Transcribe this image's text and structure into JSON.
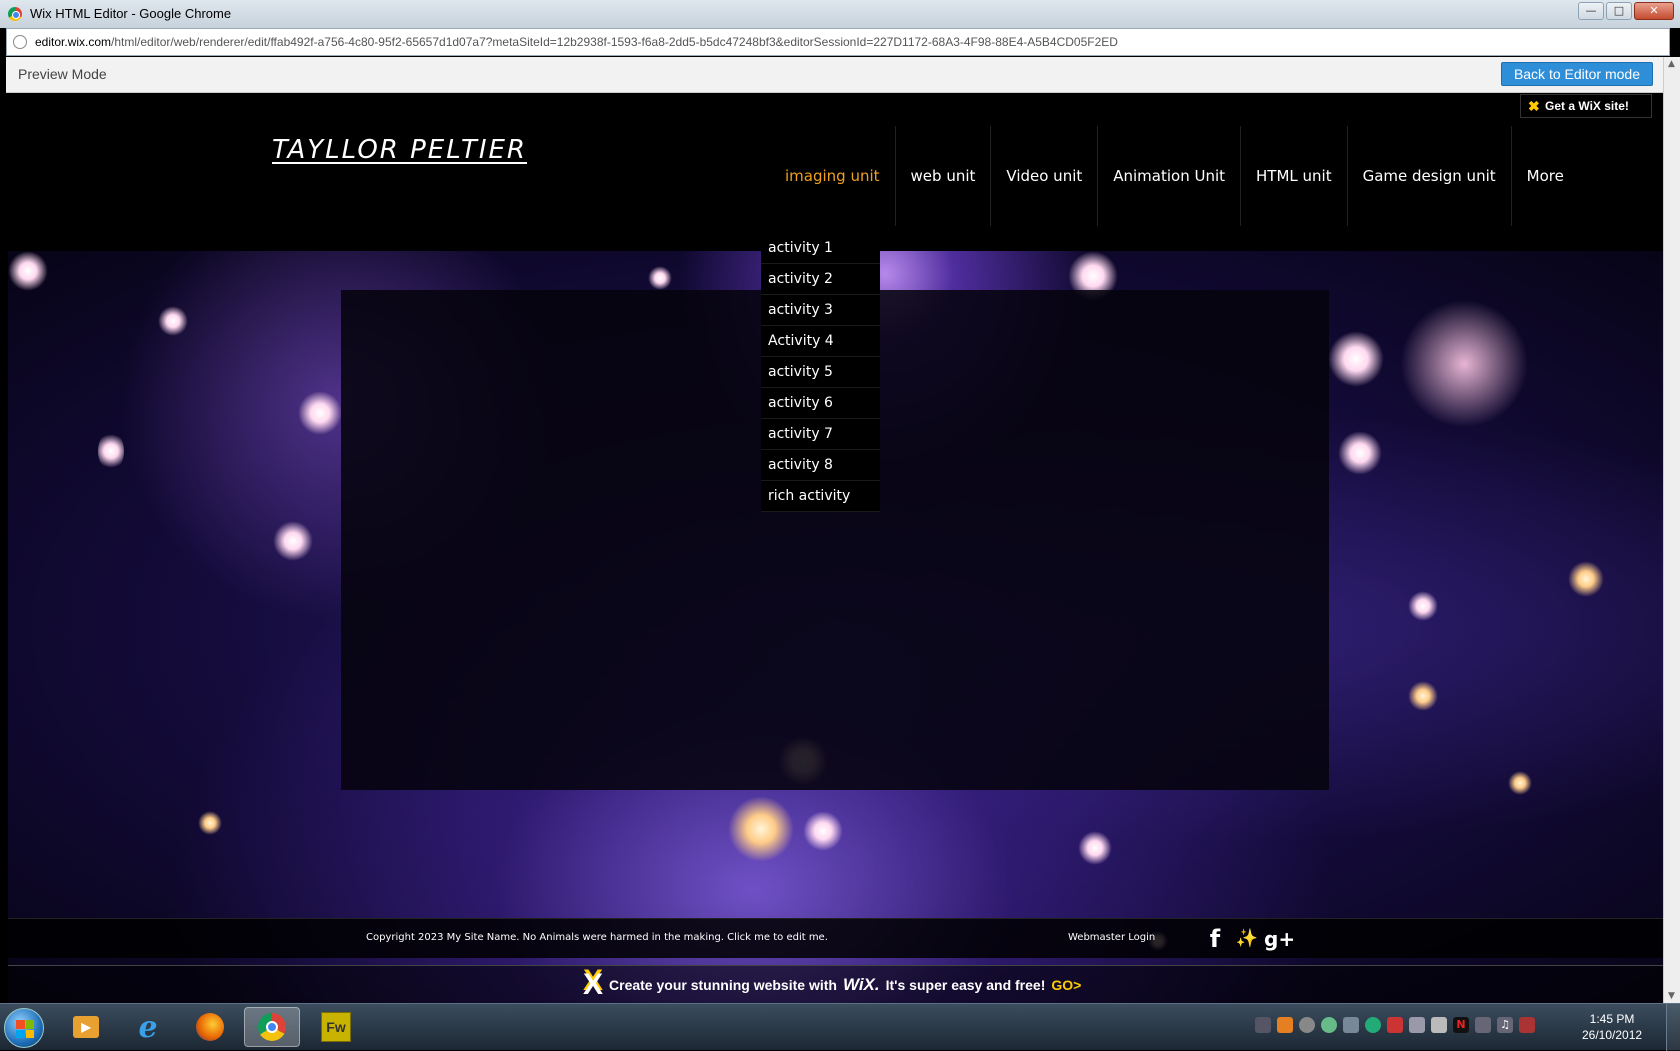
{
  "window": {
    "title": "Wix HTML Editor - Google Chrome",
    "min_icon": "minimize-icon",
    "max_icon": "maximize-icon",
    "close_icon": "close-icon"
  },
  "address": {
    "domain": "editor.wix.com",
    "path": "/html/editor/web/renderer/edit/ffab492f-a756-4c80-95f2-65657d1d07a7?metaSiteId=12b2938f-1593-f6a8-2dd5-b5dc47248bf3&editorSessionId=227D1172-68A3-4F98-88E4-A5B4CD05F2ED"
  },
  "preview": {
    "label": "Preview Mode",
    "back_button": "Back to Editor mode"
  },
  "site": {
    "title": "TAYLLOR PELTIER",
    "badge": "Get a WiX site!",
    "nav": [
      {
        "label": "imaging unit",
        "active": true
      },
      {
        "label": "web unit"
      },
      {
        "label": "Video unit"
      },
      {
        "label": "Animation Unit"
      },
      {
        "label": "HTML unit"
      },
      {
        "label": "Game design unit"
      },
      {
        "label": "More"
      }
    ],
    "dropdown": [
      "activity 1",
      "activity 2",
      "activity 3",
      "Activity 4",
      "activity 5",
      "activity 6",
      "activity 7",
      "activity 8",
      "rich activity"
    ],
    "footer": {
      "copyright": "Copyright 2023 My Site Name. No Animals were harmed in the making. Click me to edit me.",
      "login": "Webmaster Login",
      "social": [
        "facebook-icon",
        "twitter-icon",
        "google-plus-icon"
      ]
    },
    "wix_promo": {
      "text": "Create your stunning website with",
      "brand": "WiX.",
      "tagline": "It's super easy and free!",
      "go": "GO>"
    }
  },
  "taskbar": {
    "apps": [
      "media-player-icon",
      "internet-explorer-icon",
      "firefox-icon",
      "chrome-icon",
      "fireworks-icon"
    ],
    "fireworks_label": "Fw",
    "clock": {
      "time": "1:45 PM",
      "date": "26/10/2012"
    }
  },
  "colors": {
    "nav_active": "#f0a020",
    "editor_button": "#2f8ed8",
    "wix_yellow": "#ffcc00"
  }
}
